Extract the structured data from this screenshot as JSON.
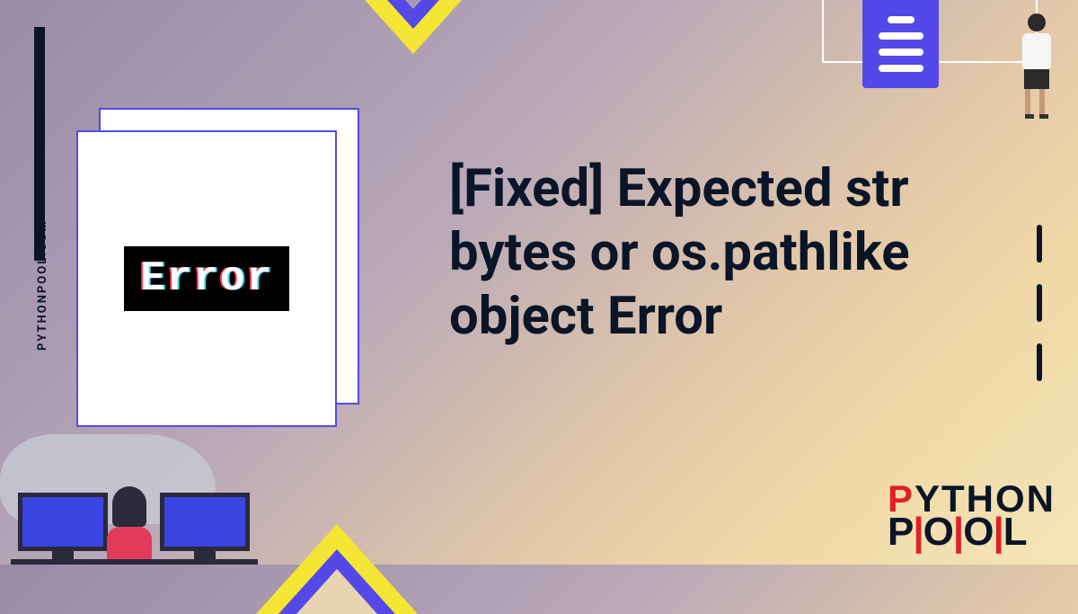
{
  "sidebar": {
    "website": "PYTHONPOOL.COM"
  },
  "card": {
    "badge_text": "Error"
  },
  "title": "[Fixed] Expected str bytes or os.pathlike object Error",
  "logo": {
    "line1_highlight": "P",
    "line1_rest": "YTHON",
    "line2": "P|O|O|L"
  }
}
